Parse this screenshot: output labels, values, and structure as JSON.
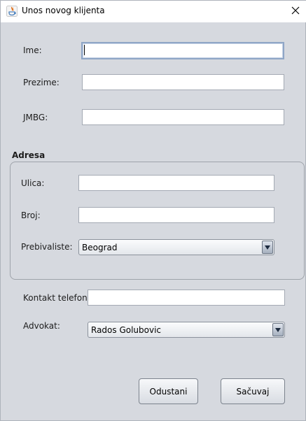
{
  "window": {
    "title": "Unos novog klijenta",
    "app_icon": "java-icon",
    "close_icon": "close-icon"
  },
  "form": {
    "ime": {
      "label": "Ime:",
      "value": ""
    },
    "prezime": {
      "label": "Prezime:",
      "value": ""
    },
    "jmbg": {
      "label": "JMBG:",
      "value": ""
    },
    "adresa": {
      "title": "Adresa",
      "ulica": {
        "label": "Ulica:",
        "value": ""
      },
      "broj": {
        "label": "Broj:",
        "value": ""
      },
      "prebivaliste": {
        "label": "Prebivaliste:",
        "selected": "Beograd"
      }
    },
    "kontakt_telefon": {
      "label": "Kontakt telefon:",
      "value": ""
    },
    "advokat": {
      "label": "Advokat:",
      "selected": "Rados Golubovic"
    }
  },
  "buttons": {
    "cancel": "Odustani",
    "save": "Sačuvaj"
  },
  "colors": {
    "background": "#d6d9df",
    "field_border": "#a3a9b3",
    "focus_border": "#8fa6c6"
  }
}
